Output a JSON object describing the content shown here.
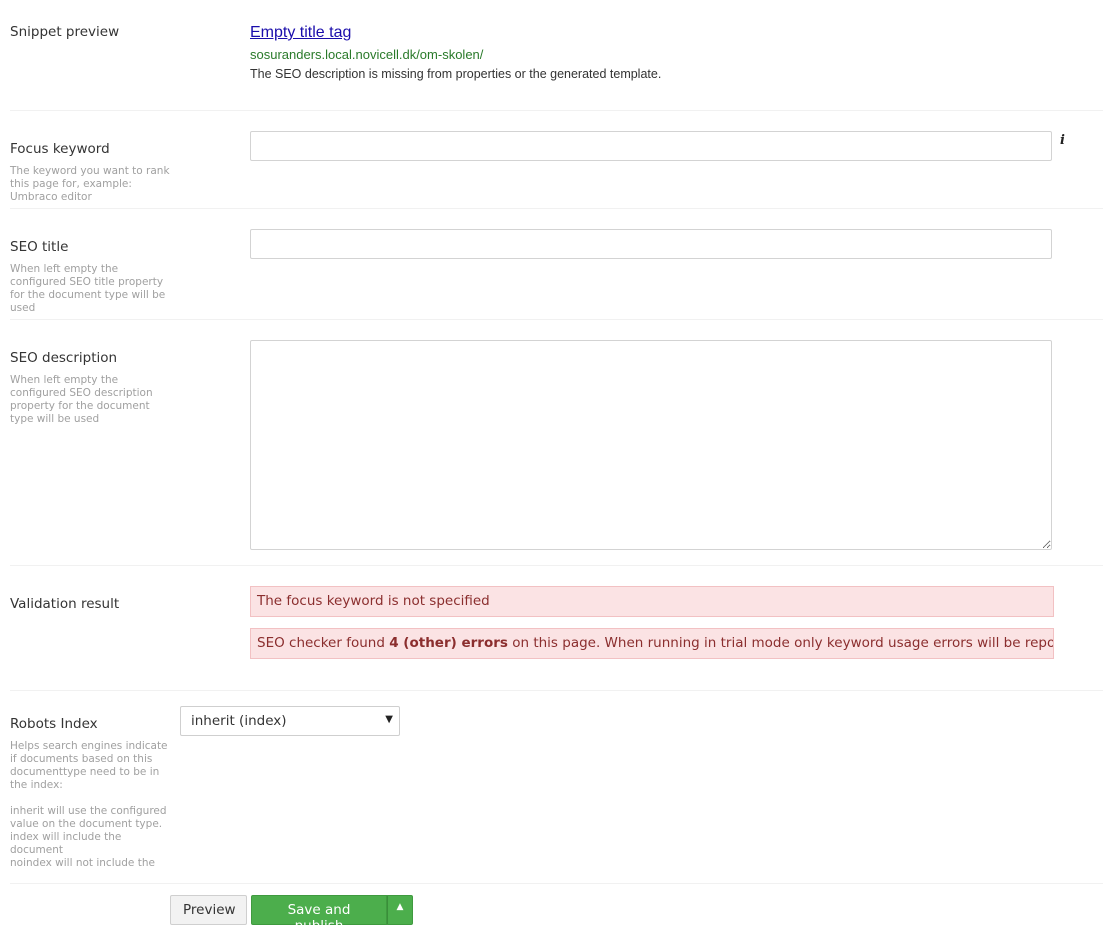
{
  "snippet": {
    "label": "Snippet preview",
    "title": "Empty title tag",
    "url": "sosuranders.local.novicell.dk/om-skolen/",
    "description": "The SEO description is missing from properties or the generated template."
  },
  "focus_keyword": {
    "label": "Focus keyword",
    "help": "The keyword you want to rank this page for, example: Umbraco editor",
    "value": "",
    "info_icon": "i"
  },
  "seo_title": {
    "label": "SEO title",
    "help": "When left empty the configured SEO title property for the document type will be used",
    "value": ""
  },
  "seo_description": {
    "label": "SEO description",
    "help": "When left empty the configured SEO description property for the document type will be used",
    "value": ""
  },
  "validation": {
    "label": "Validation result",
    "error1": "The focus keyword is not specified",
    "error2_prefix": "SEO checker found ",
    "error2_bold": "4 (other) errors",
    "error2_suffix": " on this page. When running in trial mode only keyword usage errors will be reported."
  },
  "robots": {
    "label": "Robots Index",
    "help1": "Helps search engines indicate if documents based on this documenttype need to be in the index:",
    "help2": "inherit will use the configured value on the document type.",
    "help3": "index will include the document",
    "help4": "noindex will not include the",
    "selected": "inherit (index)"
  },
  "actions": {
    "preview": "Preview",
    "save_publish": "Save and publish"
  },
  "colors": {
    "link": "#1a0dab",
    "url": "#2a7a2a",
    "error_bg": "#fbe3e4",
    "success": "#4cae4c"
  }
}
